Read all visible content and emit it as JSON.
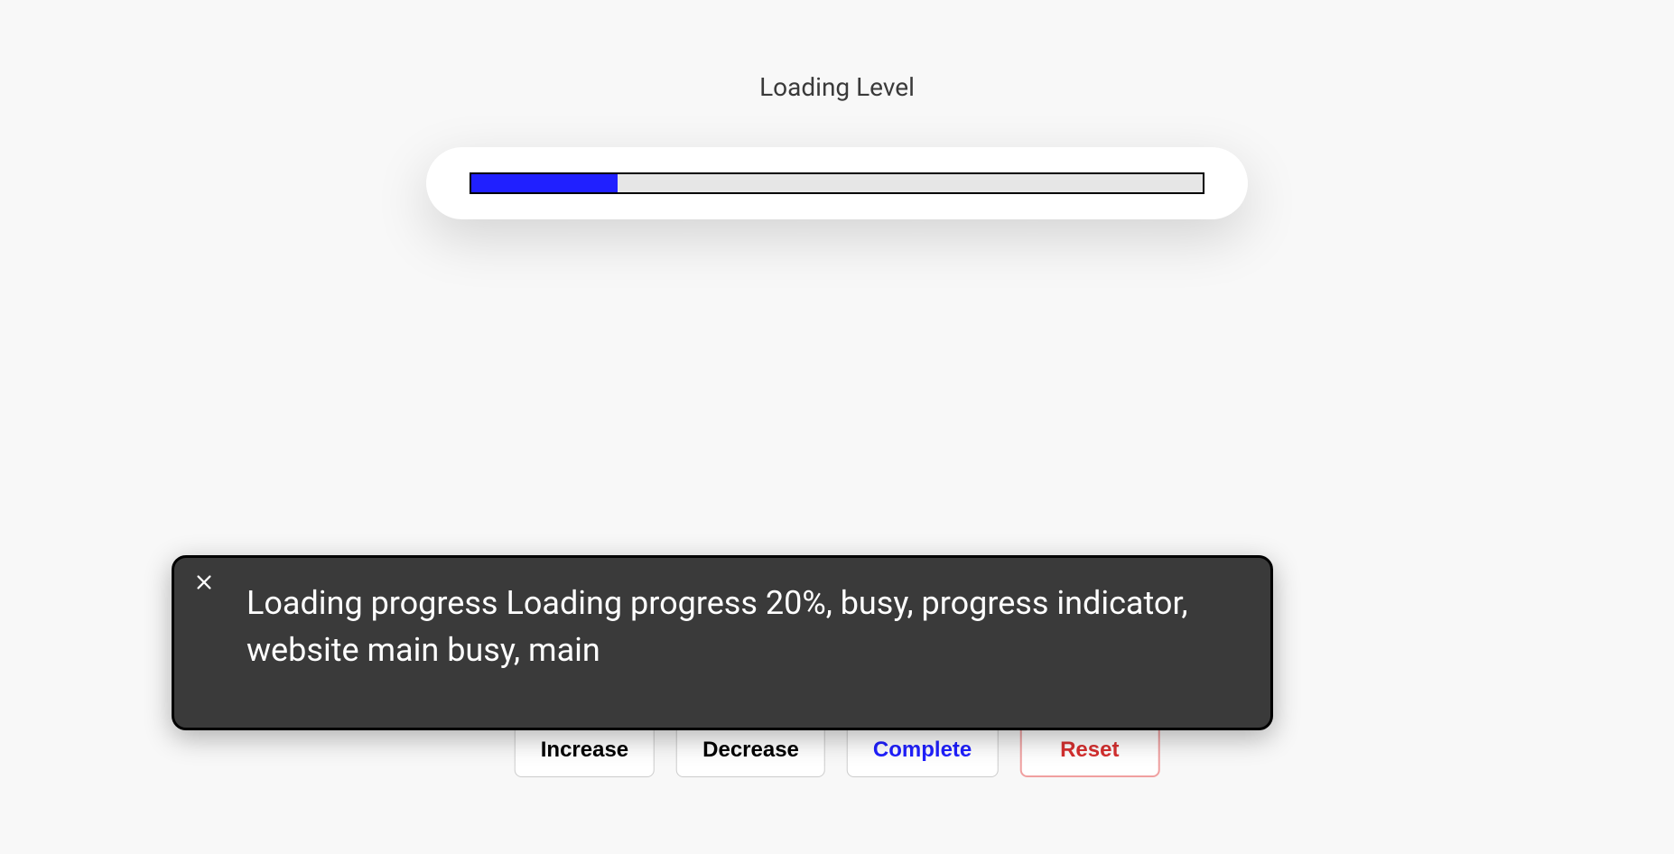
{
  "title": "Loading Level",
  "progress": {
    "percent": 20
  },
  "buttons": {
    "increase": "Increase",
    "decrease": "Decrease",
    "complete": "Complete",
    "reset": "Reset"
  },
  "overlay": {
    "text": "Loading progress Loading progress 20%, busy, progress indicator, website main busy, main"
  }
}
